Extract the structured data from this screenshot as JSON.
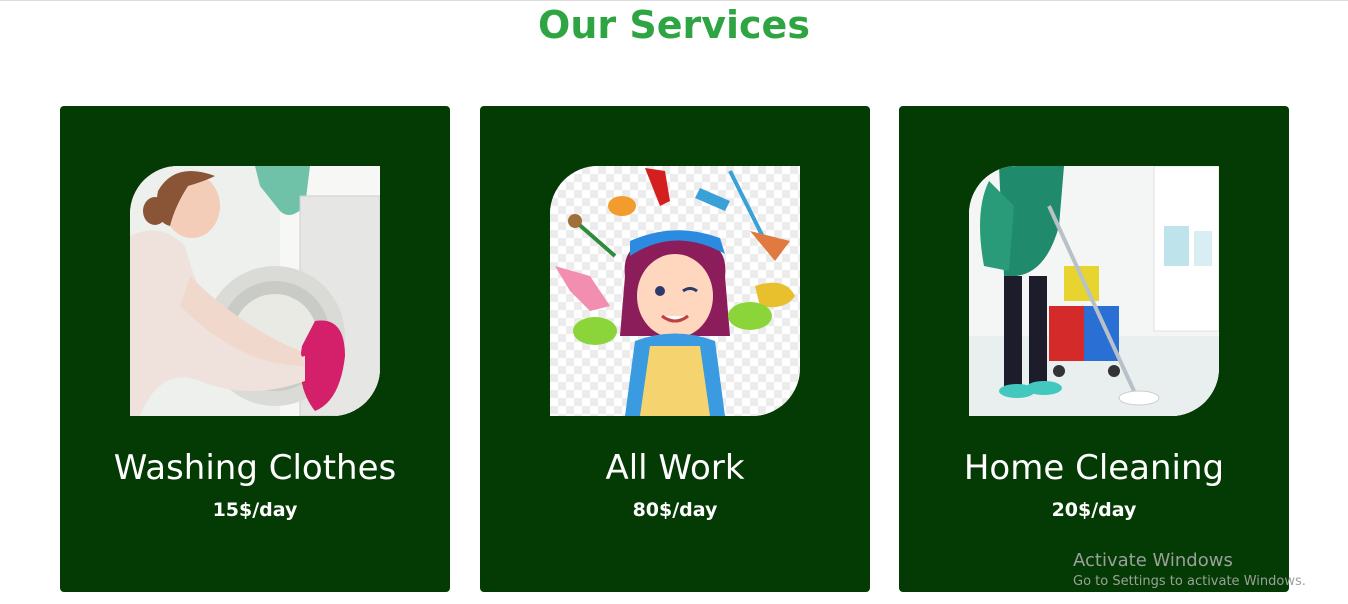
{
  "page": {
    "title": "Our Services"
  },
  "services": [
    {
      "title": "Washing Clothes",
      "price": "15$/day",
      "image_icon": "laundry-woman-photo"
    },
    {
      "title": "All Work",
      "price": "80$/day",
      "image_icon": "cleaning-lady-cartoon"
    },
    {
      "title": "Home Cleaning",
      "price": "20$/day",
      "image_icon": "mopping-floor-photo"
    }
  ],
  "watermark": {
    "line1": "Activate Windows",
    "line2": "Go to Settings to activate Windows."
  },
  "colors": {
    "heading": "#2ea542",
    "card_background": "#043a03",
    "card_text": "#ffffff"
  }
}
